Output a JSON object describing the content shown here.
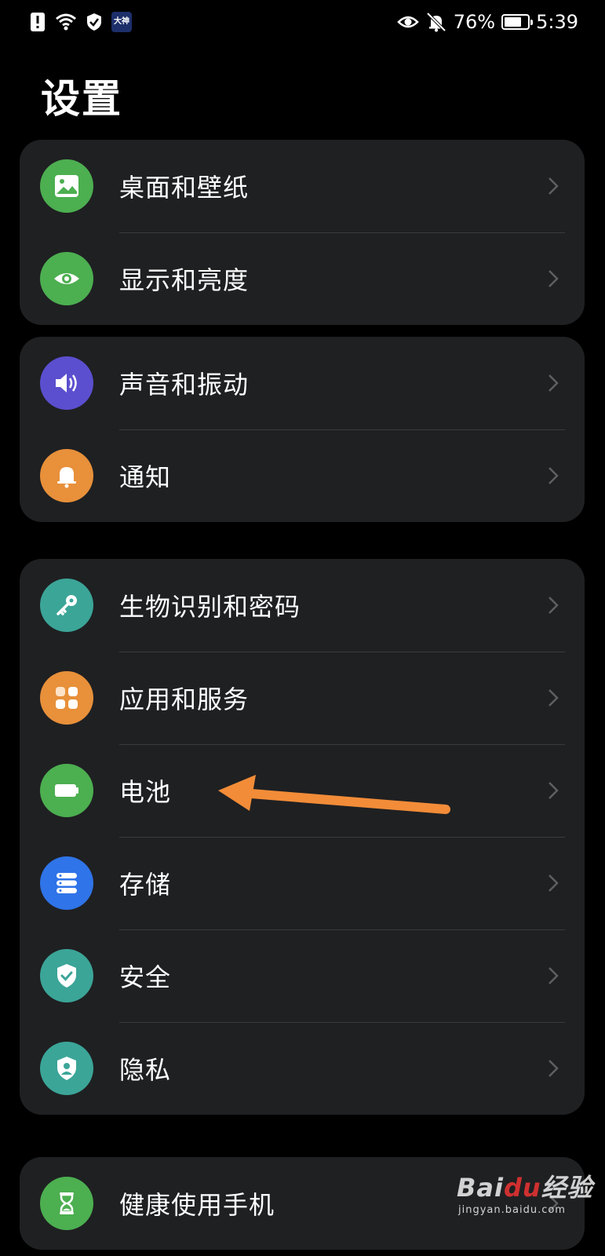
{
  "status_bar": {
    "app_badge": "大神",
    "battery_percent": "76%",
    "battery_level": 0.76,
    "time": "5:39",
    "icons": [
      "alert-notification-icon",
      "wifi-icon",
      "shield-check-icon",
      "app-badge-icon",
      "eye-comfort-icon",
      "bell-muted-icon",
      "battery-saver-icon"
    ]
  },
  "page": {
    "title": "设置"
  },
  "groups": [
    {
      "items": [
        {
          "label": "桌面和壁纸",
          "icon": "wallpaper-icon",
          "color": "#4CAF50"
        },
        {
          "label": "显示和亮度",
          "icon": "eye-icon",
          "color": "#4CAF50"
        }
      ]
    },
    {
      "items": [
        {
          "label": "声音和振动",
          "icon": "speaker-icon",
          "color": "#5B4FCF"
        },
        {
          "label": "通知",
          "icon": "bell-icon",
          "color": "#E8903A"
        }
      ]
    },
    {
      "items": [
        {
          "label": "生物识别和密码",
          "icon": "key-icon",
          "color": "#3BA598"
        },
        {
          "label": "应用和服务",
          "icon": "apps-grid-icon",
          "color": "#E8903A"
        },
        {
          "label": "电池",
          "icon": "battery-icon",
          "color": "#4CAF50"
        },
        {
          "label": "存储",
          "icon": "storage-icon",
          "color": "#2F74E8"
        },
        {
          "label": "安全",
          "icon": "shield-icon",
          "color": "#3BA598"
        },
        {
          "label": "隐私",
          "icon": "privacy-icon",
          "color": "#3BA598"
        }
      ]
    },
    {
      "items": [
        {
          "label": "健康使用手机",
          "icon": "hourglass-icon",
          "color": "#4CAF50"
        }
      ]
    }
  ],
  "annotation": {
    "arrow_color": "#F28C38",
    "points_to": "电池"
  },
  "watermark": {
    "brand": "Bai",
    "brand_paw": "du",
    "brand_suffix": "经验",
    "url": "jingyan.baidu.com"
  }
}
